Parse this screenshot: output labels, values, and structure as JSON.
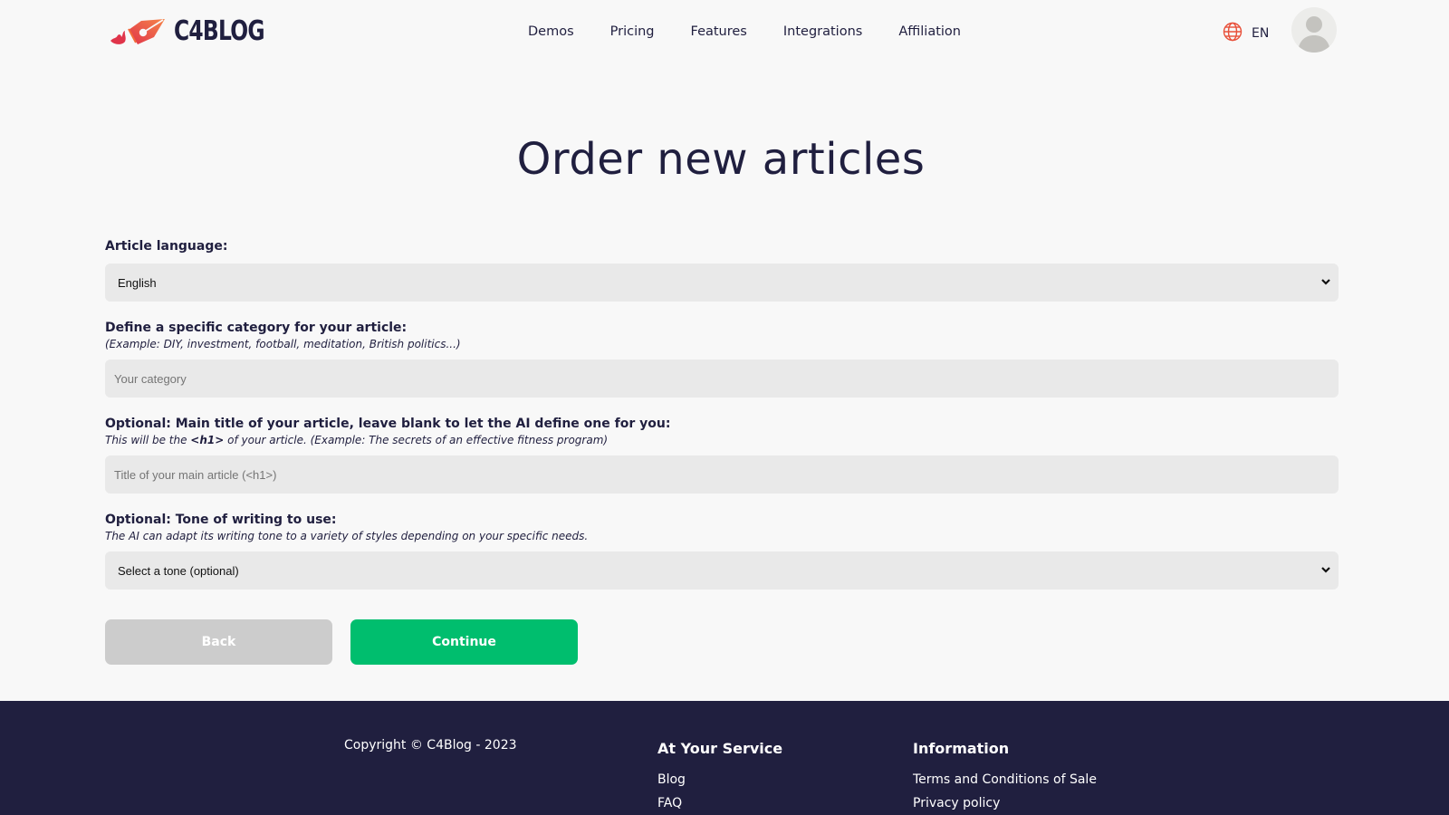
{
  "brand": {
    "name": "C4BLOG",
    "logo_icon": "fountain-pen-nib-icon",
    "colors": {
      "logo_orange": "#f26b3a",
      "logo_red": "#e0344a",
      "navy": "#201f3f",
      "accent_green": "#00be6e",
      "disabled_gray": "#cccccc"
    }
  },
  "nav": {
    "items": [
      {
        "label": "Demos"
      },
      {
        "label": "Pricing"
      },
      {
        "label": "Features"
      },
      {
        "label": "Integrations"
      },
      {
        "label": "Affiliation"
      }
    ]
  },
  "language_switcher": {
    "icon": "globe-icon",
    "label": "EN"
  },
  "user": {
    "avatar_icon": "user-avatar-icon"
  },
  "page": {
    "title": "Order new articles"
  },
  "form": {
    "language": {
      "label": "Article language:",
      "selected": "English"
    },
    "category": {
      "label": "Define a specific category for your article:",
      "hint": "(Example: DIY, investment, football, meditation, British politics...)",
      "value": "",
      "placeholder": "Your category"
    },
    "title": {
      "label": "Optional: Main title of your article, leave blank to let the AI define one for you:",
      "hint_before": "This will be the ",
      "hint_tag": "<h1>",
      "hint_after": " of your article. (Example: The secrets of an effective fitness program)",
      "value": "",
      "placeholder": "Title of your main article (<h1>)"
    },
    "tone": {
      "label": "Optional: Tone of writing to use:",
      "hint": "The AI can adapt its writing tone to a variety of styles depending on your specific needs.",
      "selected": "Select a tone (optional)"
    },
    "back_label": "Back",
    "continue_label": "Continue"
  },
  "footer": {
    "copyright": "Copyright © C4Blog - 2023",
    "service": {
      "heading": "At Your Service",
      "links": [
        {
          "label": "Blog"
        },
        {
          "label": "FAQ"
        }
      ]
    },
    "information": {
      "heading": "Information",
      "links": [
        {
          "label": "Terms and Conditions of Sale"
        },
        {
          "label": "Privacy policy"
        }
      ]
    }
  }
}
